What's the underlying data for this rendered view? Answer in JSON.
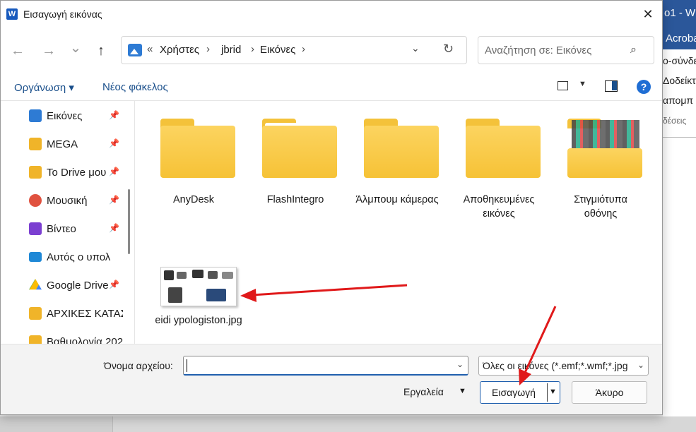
{
  "dialog": {
    "title": "Εισαγωγή εικόνας",
    "app_icon_letter": "W",
    "close_label": "✕"
  },
  "nav": {
    "back": "←",
    "forward": "→",
    "recent": "⌄",
    "up": "↑"
  },
  "address": {
    "overflow": "«",
    "crumbs": [
      "Χρήστες",
      "jbrid",
      "Εικόνες"
    ],
    "separator": "›",
    "dropdown": "⌄",
    "refresh": "↻"
  },
  "search": {
    "placeholder": "Αναζήτηση σε: Εικόνες",
    "icon": "⌕"
  },
  "toolbar": {
    "organize": "Οργάνωση ▾",
    "new_folder": "Νέος φάκελος",
    "view_dropdown": "▼",
    "help": "?"
  },
  "sidebar": {
    "items": [
      {
        "label": "Εικόνες",
        "pinned": true,
        "color": "#2e7bd4"
      },
      {
        "label": "MEGA",
        "pinned": true,
        "color": "#d9272e"
      },
      {
        "label": "Το Drive μου",
        "pinned": true,
        "color": "#34a853"
      },
      {
        "label": "Μουσική",
        "pinned": true,
        "color": "#e0513f"
      },
      {
        "label": "Βίντεο",
        "pinned": true,
        "color": "#7b3fd1"
      },
      {
        "label": "Αυτός ο υπολ",
        "pinned": false,
        "color": "#1f88d6"
      },
      {
        "label": "Google Drive",
        "pinned": true,
        "color": "#fbbc04"
      },
      {
        "label": "ΑΡΧΙΚΕΣ ΚΑΤΑΣ",
        "pinned": false,
        "color": "#f0b429"
      },
      {
        "label": "Βαθμολογία 202",
        "pinned": false,
        "color": "#f0b429"
      }
    ],
    "pin_icon": "📌"
  },
  "content": {
    "folders": [
      {
        "label": "AnyDesk",
        "variant": "plain"
      },
      {
        "label": "FlashIntegro",
        "variant": "paper"
      },
      {
        "label": "Άλμπουμ κάμερας",
        "variant": "plain"
      },
      {
        "label": "Αποθηκευμένες εικόνες",
        "variant": "plain"
      },
      {
        "label": "Στιγμιότυπα οθόνης",
        "variant": "screens"
      }
    ],
    "file": {
      "label": "eidi ypologiston.jpg"
    }
  },
  "bottom": {
    "filename_label": "Όνομα αρχείου:",
    "filename_value": "",
    "filter_text": "Όλες οι εικόνες (*.emf;*.wmf;*.jpg",
    "tools_label": "Εργαλεία",
    "insert_label": "Εισαγωγή",
    "cancel_label": "Άκυρο",
    "dropdown": "⌄",
    "tools_dropdown": "▼"
  },
  "background_word": {
    "title_fragment": "o1 - W",
    "tab_fragment": "Acroba",
    "lines": [
      "ο-σύνδε",
      "Δοδείκτ",
      "απομπ"
    ],
    "small": "δέσεις"
  },
  "colors": {
    "accent": "#1f5fae",
    "annotation_arrow": "#e0191a",
    "folder": "#f6c236"
  }
}
